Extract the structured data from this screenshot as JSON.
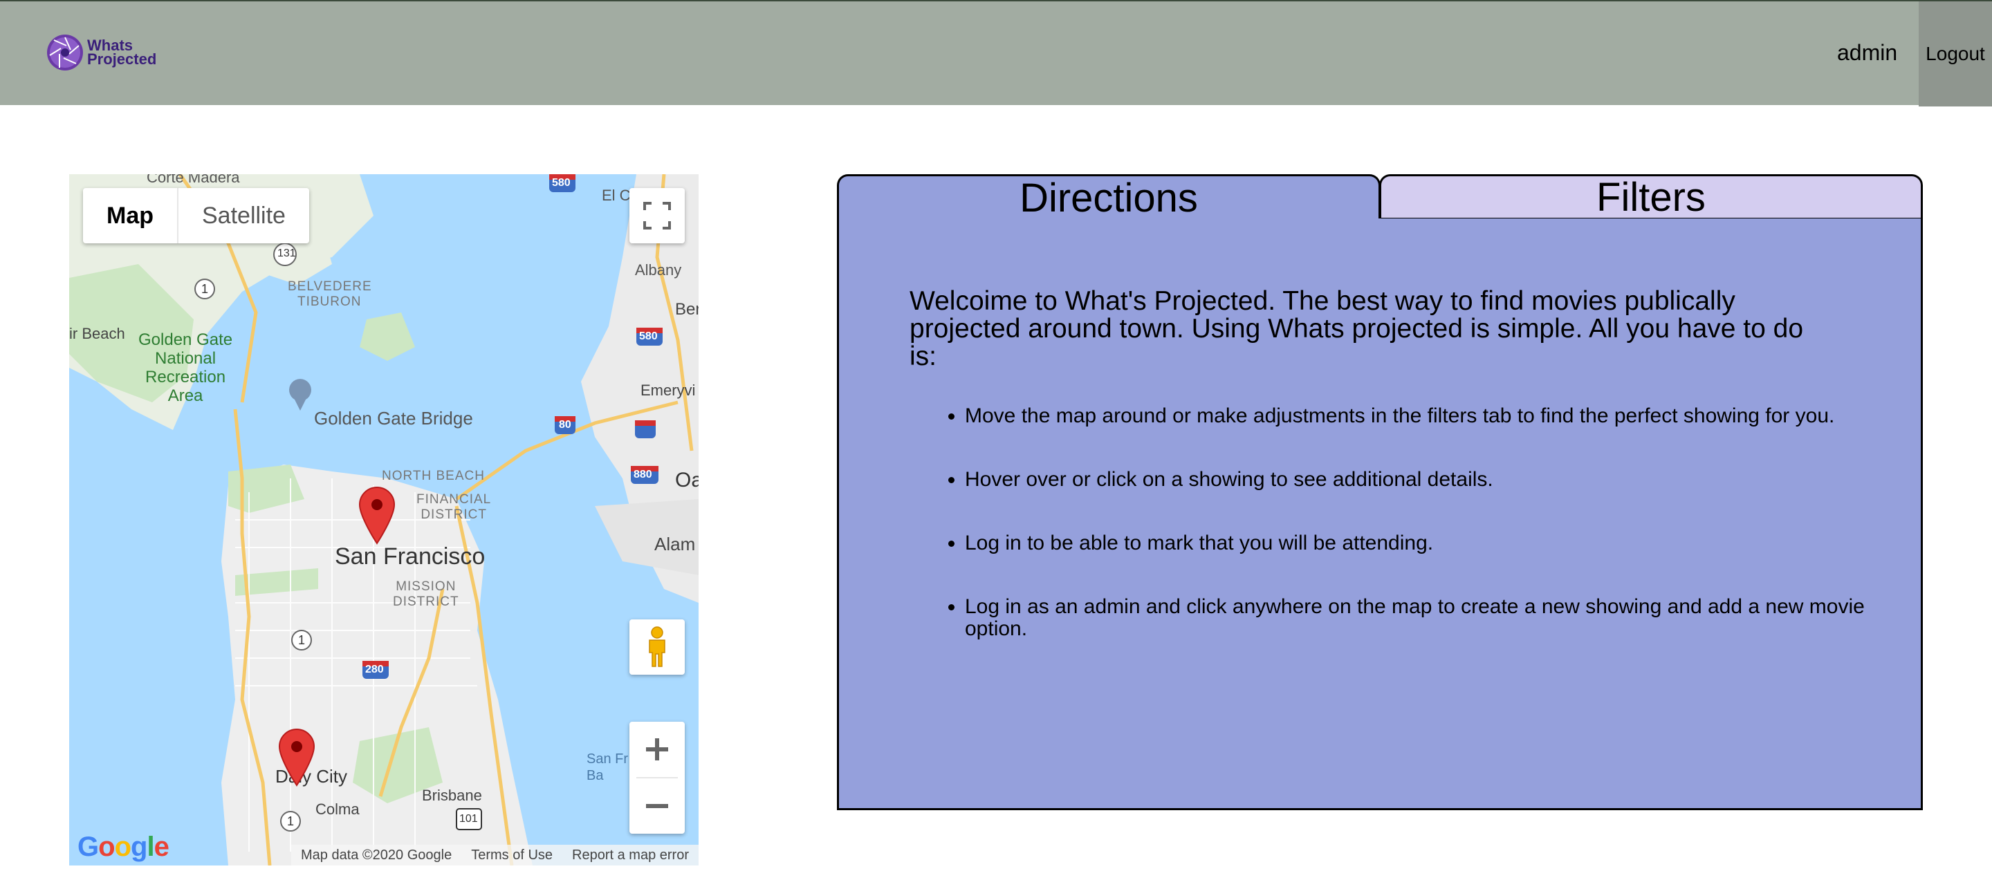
{
  "header": {
    "logo_line1": "Whats",
    "logo_line2": "Projected",
    "username": "admin",
    "logout_label": "Logout"
  },
  "map": {
    "type_map_label": "Map",
    "type_satellite_label": "Satellite",
    "places": {
      "corte_madera": "Corte Madera",
      "el_cerrito": "El C",
      "albany": "Albany",
      "belvedere": "BELVEDERE",
      "tiburon": "TIBURON",
      "berkeley": "Ber",
      "air_beach": "ir Beach",
      "golden_gate_nra": "Golden Gate\nNational\nRecreation\nArea",
      "emeryville": "Emeryvi",
      "golden_gate_bridge": "Golden Gate Bridge",
      "north_beach": "NORTH BEACH",
      "financial_district": "FINANCIAL\nDISTRICT",
      "oakland": "Oa",
      "san_francisco": "San Francisco",
      "alameda": "Alam",
      "mission_district": "MISSION\nDISTRICT",
      "daly_city": "Daly City",
      "brisbane": "Brisbane",
      "colma": "Colma",
      "san_fr_bay": "San Fr\nBa"
    },
    "shields": [
      "580",
      "131",
      "1",
      "580",
      "80",
      "880",
      "1",
      "280",
      "1",
      "101"
    ],
    "attribution_data": "Map data ©2020 Google",
    "attribution_terms": "Terms of Use",
    "attribution_report": "Report a map error",
    "google_logo": "Google"
  },
  "tabs": {
    "directions_label": "Directions",
    "filters_label": "Filters"
  },
  "directions": {
    "intro": "Welcoime to What's Projected. The best way to find movies publically projected around town. Using Whats projected is simple. All you have to do is:",
    "steps": [
      "Move the map around or make adjustments in the filters tab to find the perfect showing for you.",
      "Hover over or click on a showing to see additional details.",
      "Log in to be able to mark that you will be attending.",
      "Log in as an admin and click anywhere on the map to create a new showing and add a new movie option."
    ]
  },
  "colors": {
    "header_bg": "#a2aca2",
    "logout_bg": "#8f968f",
    "panel_bg": "#95a0dc",
    "filters_tab_bg": "#d4cdf0",
    "marker_red": "#e53935"
  }
}
